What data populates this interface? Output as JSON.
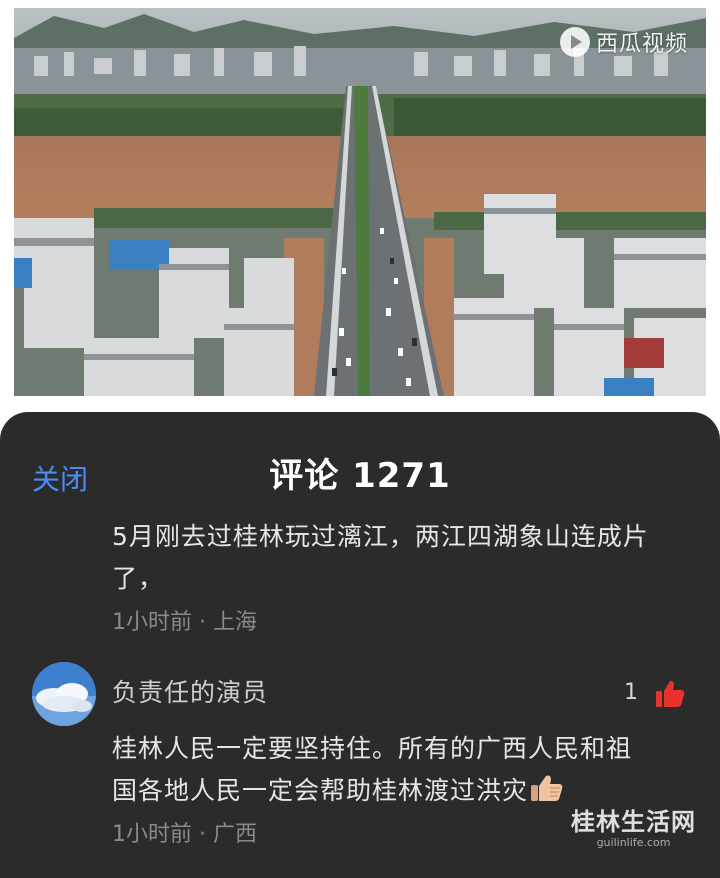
{
  "video": {
    "logo_text": "西瓜视频",
    "logo_icon": "play-circle-icon",
    "image": "aerial-flood-bridge-city"
  },
  "sheet": {
    "close_label": "关闭",
    "title": "评论 1271"
  },
  "comments": [
    {
      "text_line1": "5月刚去过桂林玩过漓江，两江四湖象山连成片",
      "text_line2": "了，",
      "meta": "1小时前 · 上海"
    },
    {
      "author": "负责任的演员",
      "likes": "1",
      "text_line1": "桂林人民一定要坚持住。所有的广西人民和祖",
      "text_line2": "国各地人民一定会帮助桂林渡过洪灾",
      "emoji": "thumbs-up-emoji",
      "meta": "1小时前 · 广西",
      "like_icon": "thumbs-up-icon"
    }
  ],
  "watermark": {
    "main": "桂林生活网",
    "sub": "guilinlife.com"
  },
  "colors": {
    "accent": "#4a8cf7",
    "like": "#e8322e",
    "sheet_bg": "#2b2b2b"
  }
}
